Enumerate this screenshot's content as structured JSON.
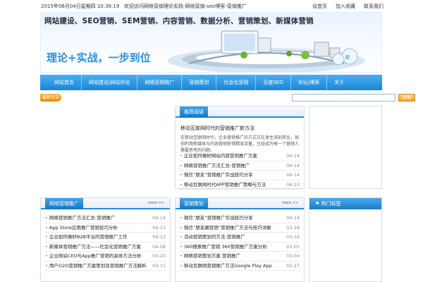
{
  "topbar": {
    "date": "2015年06月04日星期四 10:36:19",
    "slogan": "欢迎访问网络营销理论实践-网络营销-seo博客-营销推广",
    "links": [
      "设首页",
      "加入收藏",
      "联系我们"
    ]
  },
  "banner": {
    "headline": "网站建设、SEO营销、SEM营销、内容营销、数据分析、营销策划、新媒体营销",
    "tagline": "理论+实战，一步到位"
  },
  "nav": [
    "网站首页",
    "网站建设|网站优化",
    "网络营销推广",
    "营销策划",
    "社会化营销",
    "百度SEO",
    "论坛|博客",
    "关于"
  ],
  "subbar": {
    "tag": "最新公告",
    "search_placeholder": "",
    "search_button": "搜索"
  },
  "feature": {
    "header": "推荐阅读",
    "title": "移动互联网时代的营销推广新方法",
    "desc": "在移动互联网时代，企业营销推广的方式正在发生深刻变化，如何利用新媒体与内容营销获得精准流量，已经成为每一个营销人需要思考的问题。",
    "items": [
      {
        "title": "企业如何做好网站内容营销推广方案",
        "date": "04-14"
      },
      {
        "title": "网络营销推广方法汇总-营销推广",
        "date": "04-14"
      },
      {
        "title": "微信“朋友”营销推广实战技巧分享",
        "date": "04-14"
      },
      {
        "title": "移动互联网时代APP营销推广策略与方法",
        "date": "04-13"
      }
    ]
  },
  "left_panel": {
    "header": "网络营销推广",
    "more": "more >>",
    "items": [
      {
        "title": "网络营销推广方法汇总-营销推广",
        "date": "04-14"
      },
      {
        "title": "App Store应用推广营销技巧分析",
        "date": "04-13"
      },
      {
        "title": "企业如何做好B2B平台的营销推广工作",
        "date": "04-13"
      },
      {
        "title": "新媒体营销推广方法——社会化营销推广方案",
        "date": "04-08"
      },
      {
        "title": "企业网站CEO与App推广营销的具体方法分析",
        "date": "03-20"
      },
      {
        "title": "用户O2O营销推广方案策划及营销推广方法解析",
        "date": "03-11"
      }
    ]
  },
  "mid_panel": {
    "header": "营销策划",
    "more": "more >>",
    "items": [
      {
        "title": "微信“朋友”营销推广实战技巧分享",
        "date": "04-14"
      },
      {
        "title": "微信“朋友圈营销”营销推广方法与技巧详解",
        "date": "03-18"
      },
      {
        "title": "活动营销策划的方法-营销推广",
        "date": "03-16"
      },
      {
        "title": "360搜索推广营销 360营销推广方案分析",
        "date": "03-05"
      },
      {
        "title": "网络营销策划方案 营销推广",
        "date": "03-04"
      },
      {
        "title": "移动互联网营销推广方法Google Play App",
        "date": "02-27"
      }
    ]
  },
  "side_panel": {
    "header": "热门标签"
  }
}
